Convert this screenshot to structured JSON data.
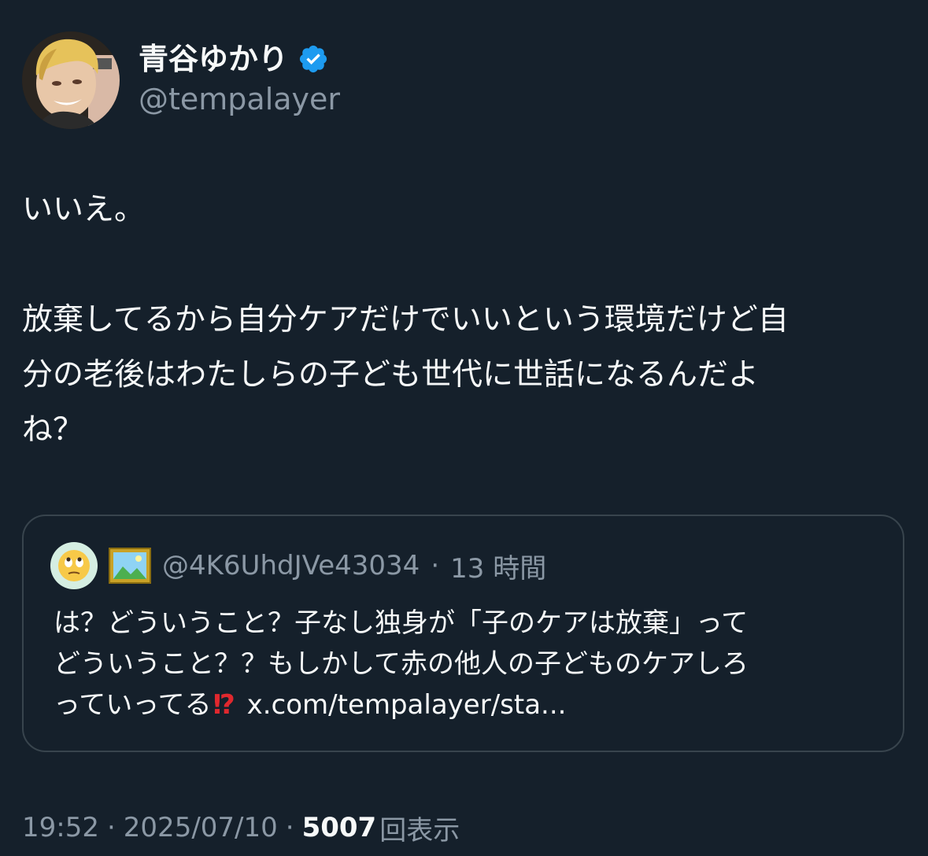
{
  "author": {
    "display_name": "青谷ゆかり",
    "handle": "@tempalayer",
    "verified_icon": "verified-badge-icon",
    "verified_color": "#1d9bf0"
  },
  "body": {
    "line1": "いいえ。",
    "line2a": "放棄してるから自分ケアだけでいいという環境だけど自",
    "line2b": "分の老後はわたしらの子ども世代に世話になるんだよ",
    "line2c": "ね？"
  },
  "quote": {
    "avatar_icon": "rolling-eyes-emoji",
    "picture_icon": "framed-picture-emoji",
    "handle": "@4K6UhdJVe43034",
    "separator": "·",
    "time": "13 時間",
    "line1": "は？どういうこと？子なし独身が「子のケアは放棄」って",
    "line2": "どういうこと？？もしかして赤の他人の子どものケアしろ",
    "line3_text": "っていってる",
    "line3_emoji": "⁉",
    "link": "x.com/tempalayer/sta..."
  },
  "meta": {
    "time": "19:52",
    "separator": "·",
    "date": "2025/07/10",
    "views_count": "5007",
    "views_label": "回表示"
  },
  "colors": {
    "background": "#15202b",
    "text_primary": "#f7f9f9",
    "text_secondary": "#8b98a5",
    "border": "#38444d"
  }
}
